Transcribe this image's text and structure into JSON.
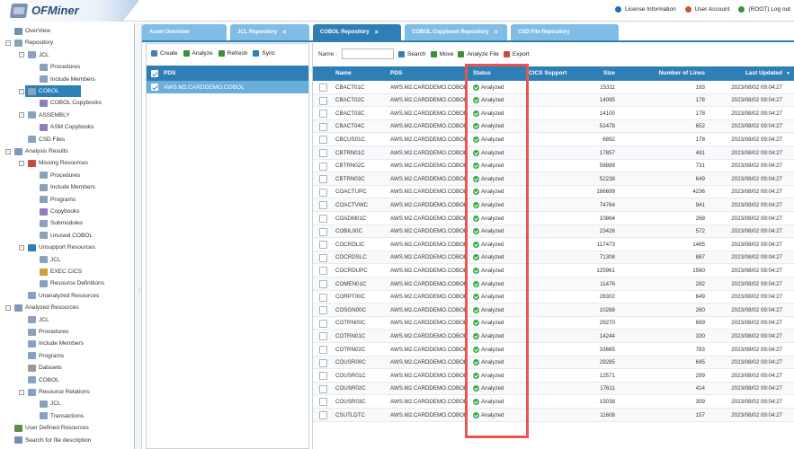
{
  "app": {
    "title": "OFMiner"
  },
  "top_links": [
    {
      "label": "License Information",
      "icon": "info-icon",
      "color": "#1e6fb3"
    },
    {
      "label": "User Account",
      "icon": "user-icon",
      "color": "#c8553d"
    },
    {
      "label": "(ROOT) Log out",
      "icon": "logout-icon",
      "color": "#3a8f3a"
    }
  ],
  "tabs": [
    {
      "label": "Asset Overview",
      "active": false,
      "closable": false
    },
    {
      "label": "JCL Repository",
      "active": false,
      "closable": true
    },
    {
      "label": "COBOL Repository",
      "active": true,
      "closable": true
    },
    {
      "label": "COBOL Copybook Repository",
      "active": false,
      "closable": true
    },
    {
      "label": "CSD File Repository",
      "active": false,
      "closable": false
    }
  ],
  "tree": [
    {
      "label": "OverView",
      "level": 0,
      "icon": "overview-icon",
      "color": "#6f8fb5"
    },
    {
      "label": "Repository",
      "level": 0,
      "icon": "repository-icon",
      "color": "#8aa1bd",
      "toggle": "-"
    },
    {
      "label": "JCL",
      "level": 1,
      "icon": "folder-icon",
      "color": "#8aa1bd",
      "toggle": "-"
    },
    {
      "label": "Procedures",
      "level": 2,
      "icon": "document-icon",
      "color": "#8aa1bd"
    },
    {
      "label": "Include Members",
      "level": 2,
      "icon": "document-icon",
      "color": "#8aa1bd"
    },
    {
      "label": "COBOL",
      "level": 1,
      "icon": "folder-icon",
      "color": "#8aa1bd",
      "toggle": "-",
      "selected": true
    },
    {
      "label": "COBOL Copybooks",
      "level": 2,
      "icon": "copybook-icon",
      "color": "#8f7fc0"
    },
    {
      "label": "ASSEMBLY",
      "level": 1,
      "icon": "folder-icon",
      "color": "#8aa1bd",
      "toggle": "-"
    },
    {
      "label": "ASM Copybooks",
      "level": 2,
      "icon": "copybook-icon",
      "color": "#8f7fc0"
    },
    {
      "label": "CSD Files",
      "level": 1,
      "icon": "folder-icon",
      "color": "#8aa1bd"
    },
    {
      "label": "Analysis Results",
      "level": 0,
      "icon": "analysis-icon",
      "color": "#7f98b8",
      "toggle": "-"
    },
    {
      "label": "Missing Resources",
      "level": 1,
      "icon": "missing-icon",
      "color": "#c94b3f",
      "toggle": "-"
    },
    {
      "label": "Procedures",
      "level": 2,
      "icon": "document-icon",
      "color": "#8aa1bd"
    },
    {
      "label": "Include Members",
      "level": 2,
      "icon": "document-icon",
      "color": "#8aa1bd"
    },
    {
      "label": "Programs",
      "level": 2,
      "icon": "document-icon",
      "color": "#8aa1bd"
    },
    {
      "label": "Copybooks",
      "level": 2,
      "icon": "copybook-icon",
      "color": "#8f7fc0"
    },
    {
      "label": "Submodules",
      "level": 2,
      "icon": "document-icon",
      "color": "#8aa1bd"
    },
    {
      "label": "Unused COBOL",
      "level": 2,
      "icon": "document-icon",
      "color": "#8aa1bd"
    },
    {
      "label": "Unsupport Resources",
      "level": 1,
      "icon": "warning-icon",
      "color": "#2f7fb7",
      "toggle": "-"
    },
    {
      "label": "JCL",
      "level": 2,
      "icon": "document-icon",
      "color": "#8aa1bd"
    },
    {
      "label": "EXEC CICS",
      "level": 2,
      "icon": "wrench-icon",
      "color": "#c9a23a"
    },
    {
      "label": "Resource Definitions",
      "level": 2,
      "icon": "document-icon",
      "color": "#8aa1bd"
    },
    {
      "label": "Unanalyzed Resources",
      "level": 1,
      "icon": "document-icon",
      "color": "#8aa1bd"
    },
    {
      "label": "Analyzed Resources",
      "level": 0,
      "icon": "analyzed-icon",
      "color": "#7f98b8",
      "toggle": "-"
    },
    {
      "label": "JCL",
      "level": 1,
      "icon": "document-icon",
      "color": "#8aa1bd"
    },
    {
      "label": "Procedures",
      "level": 1,
      "icon": "document-icon",
      "color": "#8aa1bd"
    },
    {
      "label": "Include Members",
      "level": 1,
      "icon": "document-icon",
      "color": "#8aa1bd"
    },
    {
      "label": "Programs",
      "level": 1,
      "icon": "document-icon",
      "color": "#8aa1bd"
    },
    {
      "label": "Datasets",
      "level": 1,
      "icon": "dataset-icon",
      "color": "#9a9a9a"
    },
    {
      "label": "COBOL",
      "level": 1,
      "icon": "document-icon",
      "color": "#8aa1bd"
    },
    {
      "label": "Resource Relations",
      "level": 1,
      "icon": "relations-icon",
      "color": "#8aa1bd",
      "toggle": "-"
    },
    {
      "label": "JCL",
      "level": 2,
      "icon": "document-icon",
      "color": "#8aa1bd"
    },
    {
      "label": "Transactions",
      "level": 2,
      "icon": "document-icon",
      "color": "#8aa1bd"
    },
    {
      "label": "User Defined Resources",
      "level": 0,
      "icon": "user-defined-icon",
      "color": "#5a8f4a"
    },
    {
      "label": "Search for file description",
      "level": 0,
      "icon": "search-icon",
      "color": "#6f8fb5"
    }
  ],
  "left_panel": {
    "toolbar": [
      {
        "label": "Create",
        "icon": "create-icon",
        "color": "#4a7fb5"
      },
      {
        "label": "Analyze",
        "icon": "analyze-icon",
        "color": "#3a8f3a"
      },
      {
        "label": "Refresh",
        "icon": "refresh-icon",
        "color": "#3a8f3a"
      },
      {
        "label": "Sync",
        "icon": "sync-icon",
        "color": "#2f7fb7"
      }
    ],
    "header": "PDS",
    "header_checked": true,
    "rows": [
      {
        "label": "AWS.M2.CARDDEMO.COBOL",
        "checked": true
      }
    ]
  },
  "right_panel": {
    "name_label": "Name :",
    "name_value": "",
    "toolbar": [
      {
        "label": "Search",
        "icon": "search-icon",
        "color": "#2f7fb7"
      },
      {
        "label": "Move",
        "icon": "move-icon",
        "color": "#3a8f3a"
      },
      {
        "label": "Analyze File",
        "icon": "analyze-icon",
        "color": "#3a8f3a"
      },
      {
        "label": "Export",
        "icon": "export-icon",
        "color": "#c94b3f"
      }
    ],
    "columns": [
      "Name",
      "PDS",
      "Status",
      "CICS Support",
      "Size",
      "Number of Lines",
      "Last Updated"
    ],
    "sort_indicator": "▼",
    "rows": [
      [
        "CBACT01C",
        "AWS.M2.CARDDEMO.COBOL",
        "Analyzed",
        "",
        "15311",
        "193",
        "2023/08/02 09:04:27"
      ],
      [
        "CBACT02C",
        "AWS.M2.CARDDEMO.COBOL",
        "Analyzed",
        "",
        "14095",
        "178",
        "2023/08/02 09:04:27"
      ],
      [
        "CBACT03C",
        "AWS.M2.CARDDEMO.COBOL",
        "Analyzed",
        "",
        "14100",
        "178",
        "2023/08/02 09:04:27"
      ],
      [
        "CBACT04C",
        "AWS.M2.CARDDEMO.COBOL",
        "Analyzed",
        "",
        "52478",
        "652",
        "2023/08/02 09:04:27"
      ],
      [
        "CBCUS01C",
        "AWS.M2.CARDDEMO.COBOL",
        "Analyzed",
        "",
        "6892",
        "178",
        "2023/08/02 09:04:27"
      ],
      [
        "CBTRN01C",
        "AWS.M2.CARDDEMO.COBOL",
        "Analyzed",
        "",
        "17857",
        "491",
        "2023/08/02 09:04:27"
      ],
      [
        "CBTRN02C",
        "AWS.M2.CARDDEMO.COBOL",
        "Analyzed",
        "",
        "58889",
        "731",
        "2023/08/02 09:04:27"
      ],
      [
        "CBTRN03C",
        "AWS.M2.CARDDEMO.COBOL",
        "Analyzed",
        "",
        "52238",
        "649",
        "2023/08/02 09:04:27"
      ],
      [
        "COACTUPC",
        "AWS.M2.CARDDEMO.COBOL",
        "Analyzed",
        "",
        "186699",
        "4236",
        "2023/08/02 09:04:27"
      ],
      [
        "COACTVWC",
        "AWS.M2.CARDDEMO.COBOL",
        "Analyzed",
        "",
        "74764",
        "941",
        "2023/08/02 09:04:27"
      ],
      [
        "COADM01C",
        "AWS.M2.CARDDEMO.COBOL",
        "Analyzed",
        "",
        "10864",
        "268",
        "2023/08/02 09:04:27"
      ],
      [
        "COBIL00C",
        "AWS.M2.CARDDEMO.COBOL",
        "Analyzed",
        "",
        "23426",
        "572",
        "2023/08/02 09:04:27"
      ],
      [
        "COCRDLIC",
        "AWS.M2.CARDDEMO.COBOL",
        "Analyzed",
        "",
        "117473",
        "1465",
        "2023/08/02 09:04:27"
      ],
      [
        "COCRDSLC",
        "AWS.M2.CARDDEMO.COBOL",
        "Analyzed",
        "",
        "71308",
        "887",
        "2023/08/02 09:04:27"
      ],
      [
        "COCRDUPC",
        "AWS.M2.CARDDEMO.COBOL",
        "Analyzed",
        "",
        "125961",
        "1560",
        "2023/08/02 09:04:27"
      ],
      [
        "COMEN01C",
        "AWS.M2.CARDDEMO.COBOL",
        "Analyzed",
        "",
        "11476",
        "282",
        "2023/08/02 09:04:27"
      ],
      [
        "CORPT00C",
        "AWS.M2.CARDDEMO.COBOL",
        "Analyzed",
        "",
        "28302",
        "649",
        "2023/08/02 09:04:27"
      ],
      [
        "COSGN00C",
        "AWS.M2.CARDDEMO.COBOL",
        "Analyzed",
        "",
        "10288",
        "260",
        "2023/08/02 09:04:27"
      ],
      [
        "COTRN00C",
        "AWS.M2.CARDDEMO.COBOL",
        "Analyzed",
        "",
        "29270",
        "699",
        "2023/08/02 09:04:27"
      ],
      [
        "COTRN01C",
        "AWS.M2.CARDDEMO.COBOL",
        "Analyzed",
        "",
        "14244",
        "330",
        "2023/08/02 09:04:27"
      ],
      [
        "COTRN02C",
        "AWS.M2.CARDDEMO.COBOL",
        "Analyzed",
        "",
        "33665",
        "783",
        "2023/08/02 09:04:27"
      ],
      [
        "COUSR00C",
        "AWS.M2.CARDDEMO.COBOL",
        "Analyzed",
        "",
        "29285",
        "695",
        "2023/08/02 09:04:27"
      ],
      [
        "COUSR01C",
        "AWS.M2.CARDDEMO.COBOL",
        "Analyzed",
        "",
        "12571",
        "299",
        "2023/08/02 09:04:27"
      ],
      [
        "COUSR02C",
        "AWS.M2.CARDDEMO.COBOL",
        "Analyzed",
        "",
        "17611",
        "414",
        "2023/08/02 09:04:27"
      ],
      [
        "COUSR03C",
        "AWS.M2.CARDDEMO.COBOL",
        "Analyzed",
        "",
        "15038",
        "359",
        "2023/08/02 09:04:27"
      ],
      [
        "CSUTLDTC",
        "AWS.M2.CARDDEMO.COBOL",
        "Analyzed",
        "",
        "11608",
        "157",
        "2023/08/02 09:04:27"
      ]
    ]
  },
  "colors": {
    "primary": "#2f7fb7",
    "tab_inactive": "#7fbde6",
    "selection": "#6aaedc",
    "status_ok": "#3aa845",
    "highlight": "#e8564f"
  }
}
